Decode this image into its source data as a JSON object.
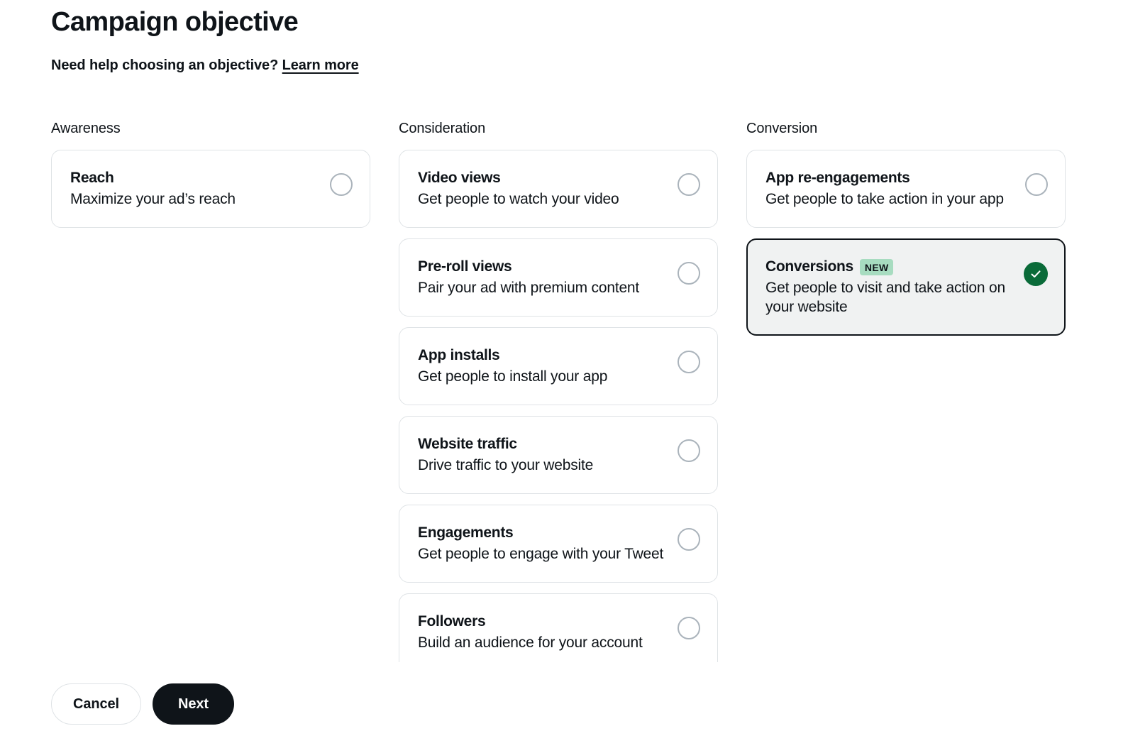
{
  "header": {
    "title": "Campaign objective",
    "help_text": "Need help choosing an objective?",
    "learn_more_label": "Learn more"
  },
  "columns": [
    {
      "title": "Awareness",
      "cards": [
        {
          "title": "Reach",
          "description": "Maximize your ad’s reach",
          "selected": false
        }
      ]
    },
    {
      "title": "Consideration",
      "cards": [
        {
          "title": "Video views",
          "description": "Get people to watch your video",
          "selected": false
        },
        {
          "title": "Pre-roll views",
          "description": "Pair your ad with premium content",
          "selected": false
        },
        {
          "title": "App installs",
          "description": "Get people to install your app",
          "selected": false
        },
        {
          "title": "Website traffic",
          "description": "Drive traffic to your website",
          "selected": false
        },
        {
          "title": "Engagements",
          "description": "Get people to engage with your Tweet",
          "selected": false
        },
        {
          "title": "Followers",
          "description": "Build an audience for your account",
          "selected": false
        }
      ]
    },
    {
      "title": "Conversion",
      "cards": [
        {
          "title": "App re-engagements",
          "description": "Get people to take action in your app",
          "selected": false
        },
        {
          "title": "Conversions",
          "badge": "NEW",
          "description": "Get people to visit and take action on your website",
          "selected": true
        }
      ]
    }
  ],
  "footer": {
    "cancel_label": "Cancel",
    "next_label": "Next"
  },
  "colors": {
    "text": "#0f1419",
    "card_border": "#dfe3e6",
    "selected_border": "#0f1419",
    "selected_bg": "#f0f2f2",
    "radio_border": "#aab3bb",
    "check_green": "#0a6b39",
    "badge_bg": "#a7dcc0",
    "next_bg": "#0f1419"
  }
}
